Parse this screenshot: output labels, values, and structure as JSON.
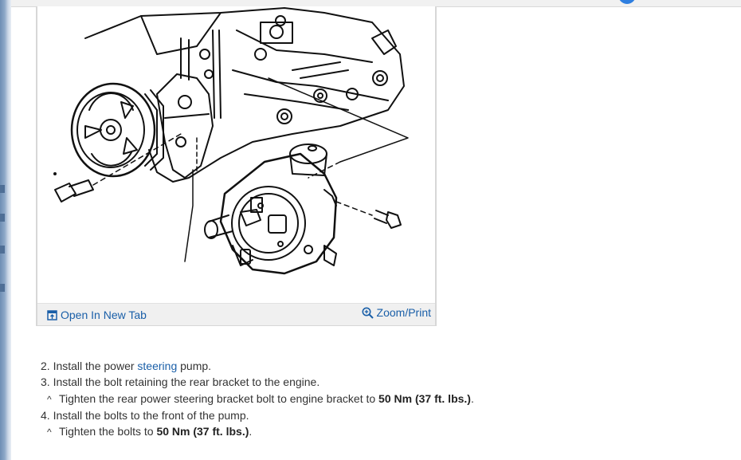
{
  "figure": {
    "open_label": "Open In New Tab",
    "zoom_label": "Zoom/Print",
    "icons": {
      "open": "open-in-new-tab-icon",
      "zoom": "zoom-in-icon"
    },
    "colors": {
      "link": "#1a5fa8",
      "toolbar_bg": "#f0f0f0"
    }
  },
  "steps": [
    {
      "num": "2.",
      "pre": "Install the power ",
      "link": "steering",
      "post": " pump."
    },
    {
      "num": "3.",
      "text": "Install the bolt retaining the rear bracket to the engine."
    },
    {
      "caret": "^",
      "pre": "Tighten the rear power steering bracket bolt to engine bracket to ",
      "bold": "50 Nm (37 ft. lbs.)",
      "post": "."
    },
    {
      "num": "4.",
      "text": "Install the bolts to the front of the pump."
    },
    {
      "caret": "^",
      "pre": "Tighten the bolts to ",
      "bold": "50 Nm (37 ft. lbs.)",
      "post": "."
    }
  ]
}
